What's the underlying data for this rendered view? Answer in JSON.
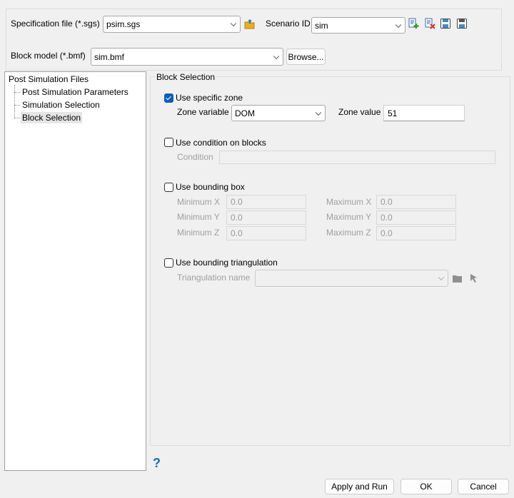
{
  "top": {
    "spec_label": "Specification file (*.sgs)",
    "spec_value": "psim.sgs",
    "scenario_label": "Scenario ID",
    "scenario_value": "sim",
    "block_label": "Block model (*.bmf)",
    "block_value": "sim.bmf",
    "browse_label": "Browse..."
  },
  "tree": {
    "root": "Post Simulation Files",
    "items": [
      "Post Simulation Parameters",
      "Simulation Selection",
      "Block Selection"
    ]
  },
  "panel": {
    "title": "Block Selection",
    "zone": {
      "label": "Use specific zone",
      "checked": true,
      "var_label": "Zone variable",
      "var_value": "DOM",
      "value_label": "Zone value",
      "value": "51"
    },
    "condition": {
      "label": "Use condition on blocks",
      "checked": false,
      "field_label": "Condition",
      "value": ""
    },
    "bbox": {
      "label": "Use bounding box",
      "checked": false,
      "min_x_label": "Minimum X",
      "min_x": "0.0",
      "max_x_label": "Maximum X",
      "max_x": "0.0",
      "min_y_label": "Minimum Y",
      "min_y": "0.0",
      "max_y_label": "Maximum Y",
      "max_y": "0.0",
      "min_z_label": "Minimum Z",
      "min_z": "0.0",
      "max_z_label": "Maximum Z",
      "max_z": "0.0"
    },
    "tri": {
      "label": "Use bounding triangulation",
      "checked": false,
      "name_label": "Triangulation name",
      "value": ""
    }
  },
  "footer": {
    "help": "?",
    "apply_run": "Apply and Run",
    "ok": "OK",
    "cancel": "Cancel"
  }
}
